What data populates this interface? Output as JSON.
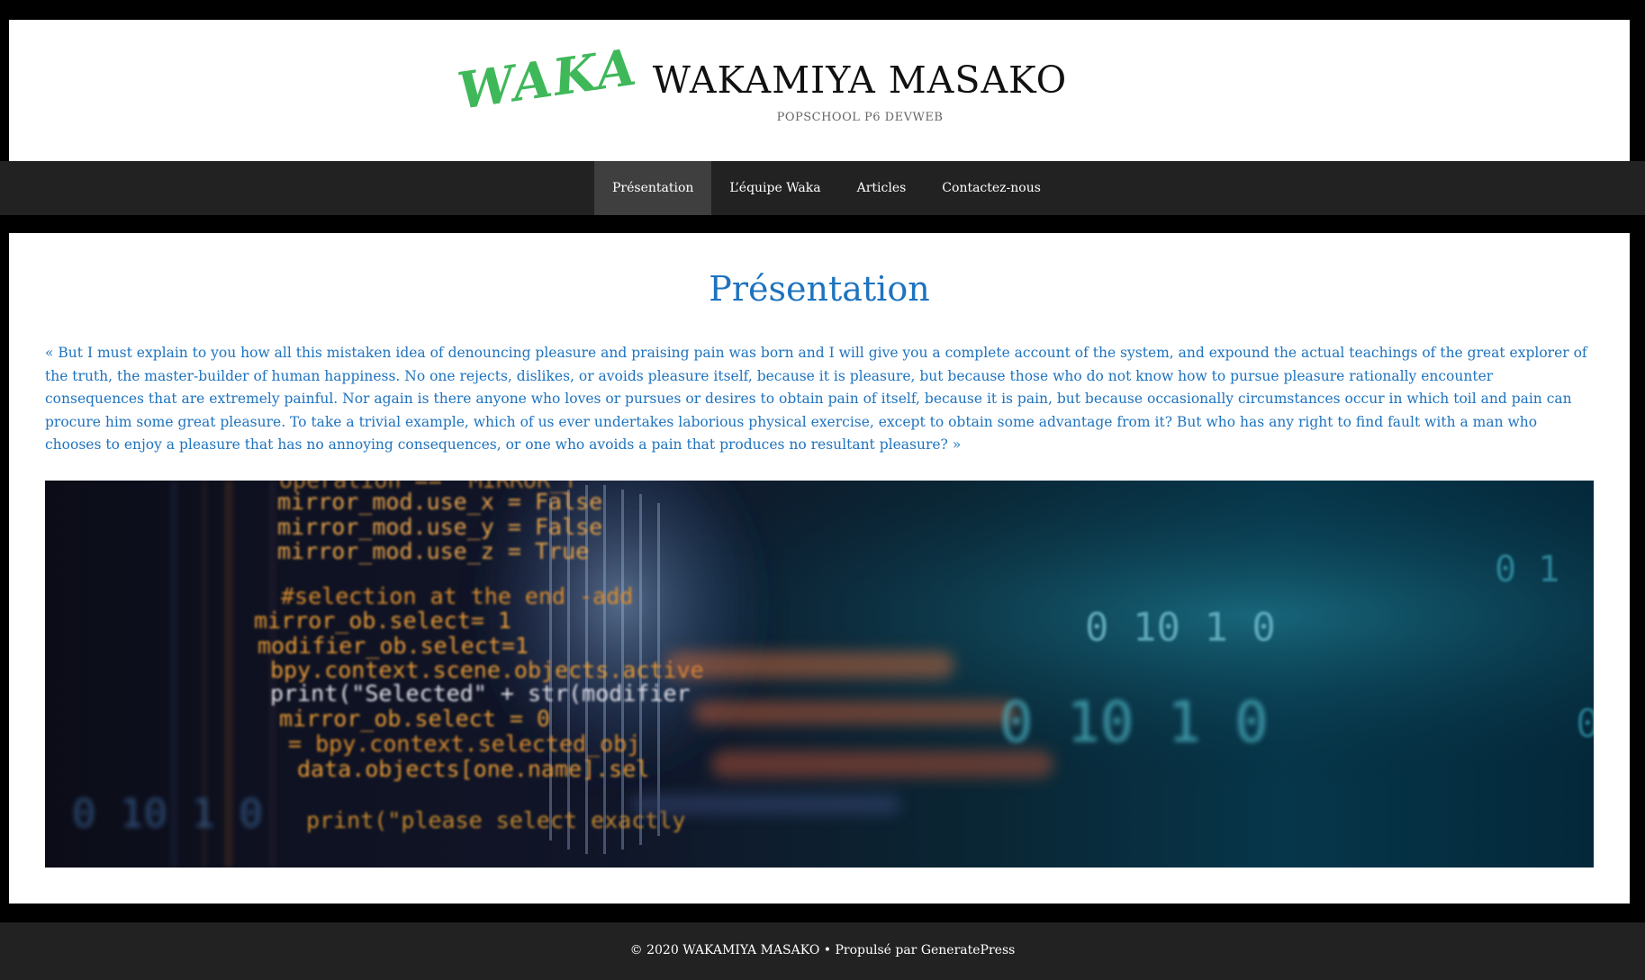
{
  "header": {
    "logo_text": "WAKA",
    "site_title": "WAKAMIYA MASAKO",
    "site_description": "POPSCHOOL P6 DEVWEB"
  },
  "nav": {
    "items": [
      {
        "label": "Présentation",
        "active": true
      },
      {
        "label": "L’équipe Waka",
        "active": false
      },
      {
        "label": "Articles",
        "active": false
      },
      {
        "label": "Contactez-nous",
        "active": false
      }
    ]
  },
  "content": {
    "title": "Présentation",
    "paragraph": "« But I must explain to you how all this mistaken idea of denouncing pleasure and praising pain was born and I will give you a complete account of the system, and expound the actual teachings of the great explorer of the truth, the master-builder of human happiness. No one rejects, dislikes, or avoids pleasure itself, because it is pleasure, but because those who do not know how to pursue pleasure rationally encounter consequences that are extremely painful. Nor again is there anyone who loves or pursues or desires to obtain pain of itself, because it is pain, but because occasionally circumstances occur in which toil and pain can procure him some great pleasure. To take a trivial example, which of us ever undertakes laborious physical exercise, except to obtain some advantage from it? But who has any right to find fault with a man who chooses to enjoy a pleasure that has no annoying consequences, or one who avoids a pain that produces no resultant pleasure? »",
    "hero_image": {
      "code_lines": [
        "operation == \"MIRROR_Y\"",
        "mirror_mod.use_x = False",
        "mirror_mod.use_y = False",
        "mirror_mod.use_z = True",
        "#selection at the end -add",
        "mirror_ob.select= 1",
        "modifier_ob.select=1",
        "bpy.context.scene.objects.active",
        "print(\"Selected\" + str(modifier",
        "mirror_ob.select = 0",
        "  = bpy.context.selected_obj",
        "data.objects[one.name].sel",
        "print(\"please select exactly"
      ],
      "binary_rows": [
        "0   1",
        "0  10 1  0",
        "0  10 1  0",
        "0  10 1  0"
      ]
    }
  },
  "footer": {
    "text": "© 2020 WAKAMIYA MASAKO • Propulsé par GeneratePress"
  },
  "colors": {
    "accent": "#1e73be",
    "logo_green": "#3fb85a",
    "nav_bg": "#222222",
    "nav_active": "#3f3f3f"
  }
}
